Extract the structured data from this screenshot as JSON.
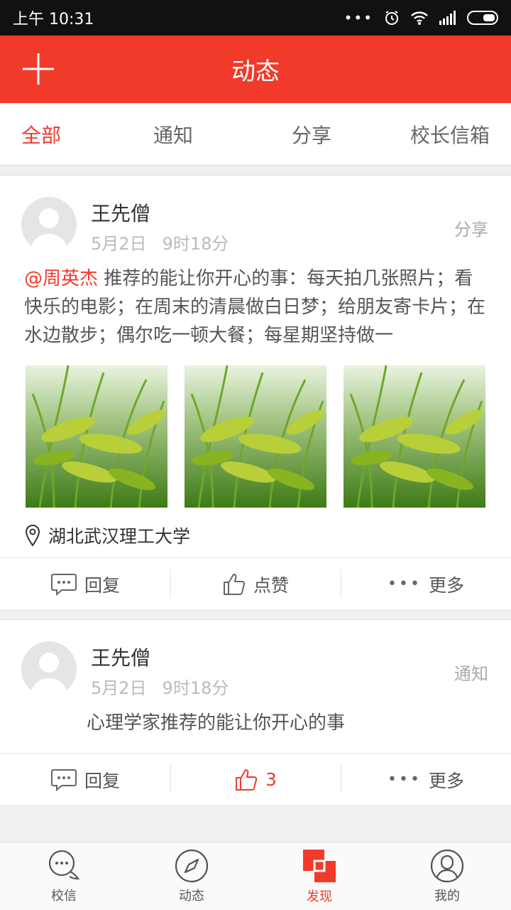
{
  "status_bar": {
    "time": "上午 10:31"
  },
  "header": {
    "title": "动态"
  },
  "tabs": [
    {
      "label": "全部",
      "active": true
    },
    {
      "label": "通知",
      "active": false
    },
    {
      "label": "分享",
      "active": false
    },
    {
      "label": "校长信箱",
      "active": false
    }
  ],
  "posts": [
    {
      "author": "王先僧",
      "date": "5月2日",
      "time": "9时18分",
      "category": "分享",
      "mention": "@周英杰",
      "text": " 推荐的能让你开心的事：每天拍几张照片；看快乐的电影；在周末的清晨做白日梦；给朋友寄卡片；在水边散步；偶尔吃一顿大餐；每星期坚持做一",
      "location": "湖北武汉理工大学",
      "reply_label": "回复",
      "like_label": "点赞",
      "more_label": "更多"
    },
    {
      "author": "王先僧",
      "date": "5月2日",
      "time": "9时18分",
      "category": "通知",
      "text": "心理学家推荐的能让你开心的事",
      "reply_label": "回复",
      "like_count": "3",
      "more_label": "更多"
    }
  ],
  "bottom_nav": [
    {
      "label": "校信",
      "icon": "chat-icon"
    },
    {
      "label": "动态",
      "icon": "compass-icon"
    },
    {
      "label": "发现",
      "icon": "discover-icon",
      "active": true
    },
    {
      "label": "我的",
      "icon": "profile-icon"
    }
  ],
  "colors": {
    "accent": "#f13a2a",
    "status_bar": "#111111"
  }
}
